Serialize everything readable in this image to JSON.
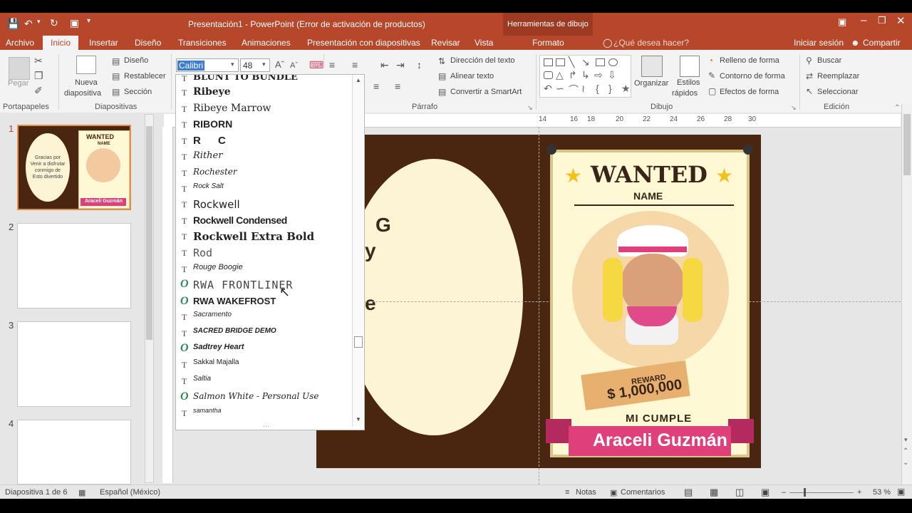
{
  "window": {
    "title": "Presentación1 - PowerPoint (Error de activación de productos)",
    "context_group": "Herramientas de dibujo",
    "controls": [
      "restore-ribbon",
      "minimize",
      "maximize",
      "close"
    ]
  },
  "tabs": [
    {
      "label": "Archivo"
    },
    {
      "label": "Inicio"
    },
    {
      "label": "Insertar"
    },
    {
      "label": "Diseño"
    },
    {
      "label": "Transiciones"
    },
    {
      "label": "Animaciones"
    },
    {
      "label": "Presentación con diapositivas"
    },
    {
      "label": "Revisar"
    },
    {
      "label": "Vista"
    },
    {
      "label": "Formato"
    }
  ],
  "tell_me": "¿Qué desea hacer?",
  "signin": "Iniciar sesión",
  "share": "Compartir",
  "ribbon": {
    "paste": "Pegar",
    "new_slide_line1": "Nueva",
    "new_slide_line2": "diapositiva",
    "layout": "Diseño",
    "reset": "Restablecer",
    "section": "Sección",
    "font_name": "Calibri",
    "font_size": "48",
    "text_direction": "Dirección del texto",
    "align_text": "Alinear texto",
    "smartart": "Convertir a SmartArt",
    "arrange": "Organizar",
    "quick_styles_line1": "Estilos",
    "quick_styles_line2": "rápidos",
    "shape_fill": "Relleno de forma",
    "shape_outline": "Contorno de forma",
    "shape_effects": "Efectos de forma",
    "find": "Buscar",
    "replace": "Reemplazar",
    "select": "Seleccionar",
    "groups": {
      "clipboard": "Portapapeles",
      "slides": "Diapositivas",
      "paragraph": "Párrafo",
      "drawing": "Dibujo",
      "editing": "Edición"
    }
  },
  "ruler": {
    "h_ticks": [
      "14",
      "16",
      "18",
      "20",
      "22",
      "24",
      "26",
      "28",
      "30"
    ]
  },
  "font_list": [
    {
      "name": "BLUNT TO BUNDLE",
      "type": "T"
    },
    {
      "name": "Ribeye",
      "type": "T"
    },
    {
      "name": "Ribeye Marrow",
      "type": "T"
    },
    {
      "name": "RIBORN",
      "type": "T"
    },
    {
      "name": "R C",
      "type": "T"
    },
    {
      "name": "Rither",
      "type": "T"
    },
    {
      "name": "Rochester",
      "type": "T"
    },
    {
      "name": "Rock Salt",
      "type": "T"
    },
    {
      "name": "Rockwell",
      "type": "T"
    },
    {
      "name": "Rockwell Condensed",
      "type": "T"
    },
    {
      "name": "Rockwell Extra Bold",
      "type": "T"
    },
    {
      "name": "Rod",
      "type": "T"
    },
    {
      "name": "Rouge Boogie",
      "type": "T"
    },
    {
      "name": "RWA FRONTLINER",
      "type": "O"
    },
    {
      "name": "RWA WAKEFROST",
      "type": "O"
    },
    {
      "name": "Sacramento",
      "type": "T"
    },
    {
      "name": "SACRED BRIDGE DEMO",
      "type": "T"
    },
    {
      "name": "Sadtrey Heart",
      "type": "O"
    },
    {
      "name": "Sakkal Majalla",
      "type": "T"
    },
    {
      "name": "Saltia",
      "type": "T"
    },
    {
      "name": "Salmon White - Personal Use",
      "type": "O"
    },
    {
      "name": "samantha",
      "type": "T"
    }
  ],
  "thumbnails": [
    {
      "number": "1",
      "selected": true,
      "oval_text": "Gracias por Venir a disfrutar conmigo de Esto divertido",
      "poster_title": "WANTED",
      "poster_sub": "NAME",
      "poster_name": "Araceli Guzmán"
    },
    {
      "number": "2"
    },
    {
      "number": "3"
    },
    {
      "number": "4"
    }
  ],
  "slide": {
    "partial_letters": [
      "G",
      "y",
      "e"
    ],
    "poster": {
      "title": "WANTED",
      "name_label": "NAME",
      "reward_label": "REWARD",
      "reward_amount": "$ 1,000,000",
      "event": "MI CUMPLE",
      "person": "Araceli Guzmán"
    }
  },
  "status": {
    "slide_info": "Diapositiva 1 de 6",
    "language": "Español (México)",
    "notes": "Notas",
    "comments": "Comentarios",
    "zoom": "53 %"
  },
  "colors": {
    "titlebar": "#b7472a",
    "slide_bg": "#4a250f",
    "oval": "#fdf4d6",
    "banner": "#e0407a",
    "star": "#f2c21b"
  }
}
